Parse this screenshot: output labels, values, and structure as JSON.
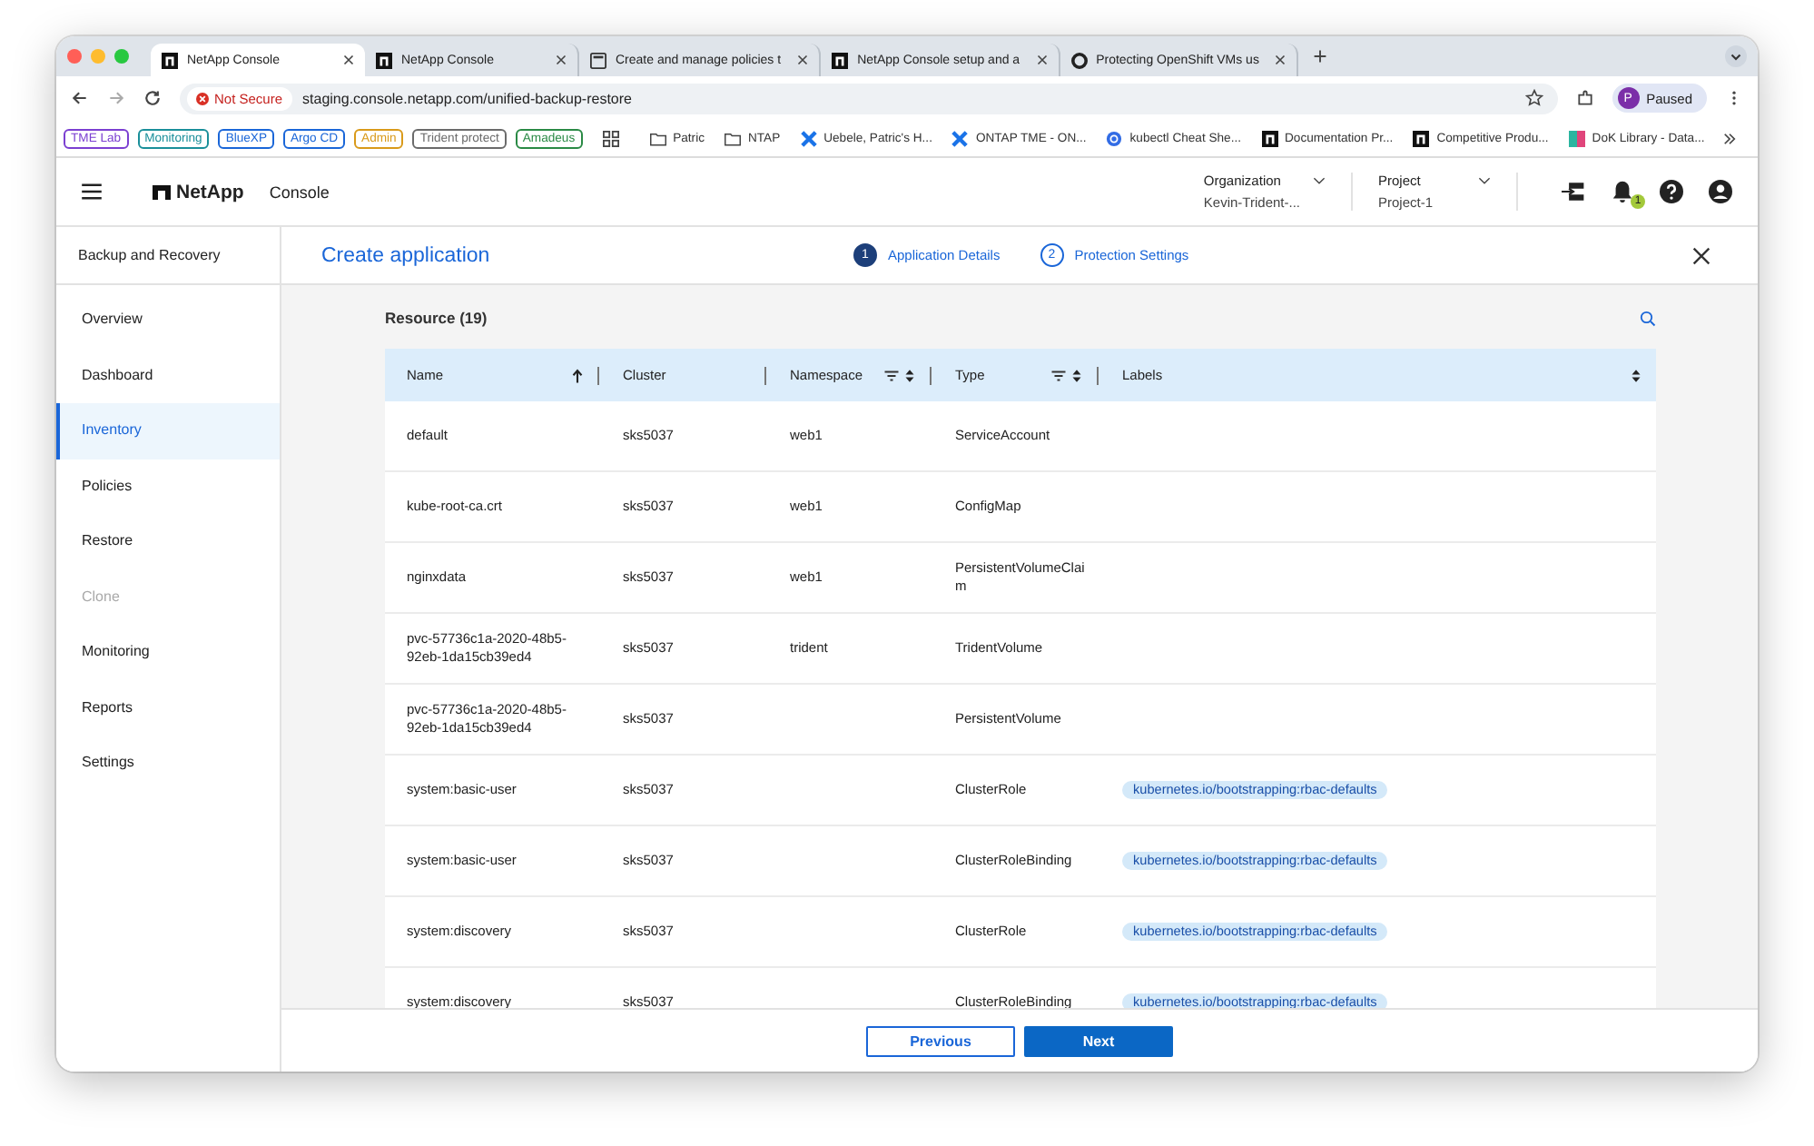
{
  "browser": {
    "tabs": [
      {
        "title": "NetApp Console",
        "kind": "netapp",
        "selected": true
      },
      {
        "title": "NetApp Console",
        "kind": "netapp",
        "selected": false
      },
      {
        "title": "Create and manage policies t",
        "kind": "page",
        "selected": false
      },
      {
        "title": "NetApp Console setup and a",
        "kind": "netapp",
        "selected": false
      },
      {
        "title": "Protecting OpenShift VMs us",
        "kind": "openshift",
        "selected": false
      }
    ],
    "security": "Not Secure",
    "url": "staging.console.netapp.com/unified-backup-restore",
    "profile_initial": "P",
    "profile_label": "Paused",
    "bookmarks": [
      {
        "label": "TME Lab",
        "kind": "tag",
        "color": "#7b3fd1"
      },
      {
        "label": "Monitoring",
        "kind": "tag",
        "color": "#1a8f9a"
      },
      {
        "label": "BlueXP",
        "kind": "tag",
        "color": "#1a66d8"
      },
      {
        "label": "Argo CD",
        "kind": "tag",
        "color": "#1a66d8"
      },
      {
        "label": "Admin",
        "kind": "tag",
        "color": "#d99a1a"
      },
      {
        "label": "Trident protect",
        "kind": "tag",
        "color": "#6b6b6b"
      },
      {
        "label": "Amadeus",
        "kind": "tag",
        "color": "#2a8a45"
      },
      {
        "label": "Patric",
        "kind": "folder"
      },
      {
        "label": "NTAP",
        "kind": "folder"
      },
      {
        "label": "Uebele, Patric's H...",
        "kind": "cross"
      },
      {
        "label": "ONTAP TME - ON...",
        "kind": "cross"
      },
      {
        "label": "kubectl Cheat She...",
        "kind": "kube"
      },
      {
        "label": "Documentation Pr...",
        "kind": "netapp"
      },
      {
        "label": "Competitive Produ...",
        "kind": "netapp"
      },
      {
        "label": "DoK Library - Data...",
        "kind": "dok"
      }
    ]
  },
  "header": {
    "brand": "NetApp",
    "product": "Console",
    "organization_label": "Organization",
    "organization": "Kevin-Trident-...",
    "project_label": "Project",
    "project": "Project-1",
    "notification_count": "1"
  },
  "sidebar": {
    "title": "Backup and Recovery",
    "items": [
      {
        "label": "Overview",
        "selected": false,
        "disabled": false
      },
      {
        "label": "Dashboard",
        "selected": false,
        "disabled": false
      },
      {
        "label": "Inventory",
        "selected": true,
        "disabled": false
      },
      {
        "label": "Policies",
        "selected": false,
        "disabled": false
      },
      {
        "label": "Restore",
        "selected": false,
        "disabled": false
      },
      {
        "label": "Clone",
        "selected": false,
        "disabled": true
      },
      {
        "label": "Monitoring",
        "selected": false,
        "disabled": false
      },
      {
        "label": "Reports",
        "selected": false,
        "disabled": false
      },
      {
        "label": "Settings",
        "selected": false,
        "disabled": false
      }
    ]
  },
  "wizard": {
    "title": "Create application",
    "steps": [
      {
        "number": "1",
        "label": "Application Details",
        "selected": true
      },
      {
        "number": "2",
        "label": "Protection Settings",
        "selected": false
      }
    ]
  },
  "table": {
    "title": "Resource (19)",
    "columns": [
      {
        "label": "Name",
        "sorted_ascending": true,
        "filter": false
      },
      {
        "label": "Cluster",
        "sortable": false,
        "sorted_ascending": false,
        "filter": false
      },
      {
        "label": "Namespace",
        "sortable": true,
        "sorted_ascending": false,
        "filter": true
      },
      {
        "label": "Type",
        "sortable": true,
        "sorted_ascending": false,
        "filter": true
      },
      {
        "label": "Labels",
        "sortable": true,
        "sorted_ascending": false,
        "filter": false
      }
    ],
    "rows": [
      {
        "name": "default",
        "cluster": "sks5037",
        "namespace": "web1",
        "type": "ServiceAccount",
        "labels": []
      },
      {
        "name": "kube-root-ca.crt",
        "cluster": "sks5037",
        "namespace": "web1",
        "type": "ConfigMap",
        "labels": []
      },
      {
        "name": "nginxdata",
        "cluster": "sks5037",
        "namespace": "web1",
        "type": "PersistentVolumeClaim",
        "labels": []
      },
      {
        "name": "pvc-57736c1a-2020-48b5-92eb-1da15cb39ed4",
        "cluster": "sks5037",
        "namespace": "trident",
        "type": "TridentVolume",
        "labels": []
      },
      {
        "name": "pvc-57736c1a-2020-48b5-92eb-1da15cb39ed4",
        "cluster": "sks5037",
        "namespace": "",
        "type": "PersistentVolume",
        "labels": []
      },
      {
        "name": "system:basic-user",
        "cluster": "sks5037",
        "namespace": "",
        "type": "ClusterRole",
        "labels": [
          "kubernetes.io/bootstrapping:rbac-defaults"
        ]
      },
      {
        "name": "system:basic-user",
        "cluster": "sks5037",
        "namespace": "",
        "type": "ClusterRoleBinding",
        "labels": [
          "kubernetes.io/bootstrapping:rbac-defaults"
        ]
      },
      {
        "name": "system:discovery",
        "cluster": "sks5037",
        "namespace": "",
        "type": "ClusterRole",
        "labels": [
          "kubernetes.io/bootstrapping:rbac-defaults"
        ]
      },
      {
        "name": "system:discovery",
        "cluster": "sks5037",
        "namespace": "",
        "type": "ClusterRoleBinding",
        "labels": [
          "kubernetes.io/bootstrapping:rbac-defaults"
        ]
      }
    ]
  },
  "footer": {
    "previous": "Previous",
    "next": "Next"
  }
}
